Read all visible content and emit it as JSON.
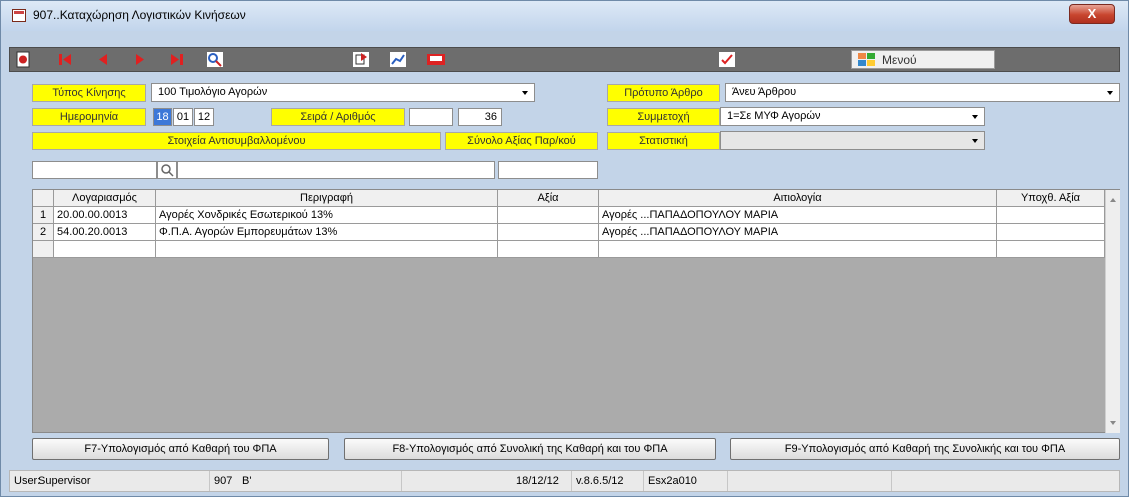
{
  "window": {
    "title": "907..Καταχώρηση Λογιστικών Κινήσεων",
    "close_label": "X"
  },
  "toolbar": {
    "icons": [
      "record-icon",
      "first-icon",
      "prev-icon",
      "next-icon",
      "last-icon",
      "search-icon",
      "copy-icon",
      "chart-icon",
      "print-icon",
      "check-icon",
      "menu-icon"
    ],
    "menu_label": "Μενού"
  },
  "form": {
    "movement_type_label": "Τύπος Κίνησης",
    "movement_type_value": "100 Τιμολόγιο Αγορών",
    "template_label": "Πρότυπο Άρθρο",
    "template_value": "Άνευ Άρθρου",
    "date_label": "Ημερομηνία",
    "date_day": "18",
    "date_month": "01",
    "date_year": "12",
    "series_label": "Σειρά / Αριθμός",
    "series_value": "",
    "number_value": "36",
    "participation_label": "Συμμετοχή",
    "participation_value": "1=Σε ΜΥΦ Αγορών",
    "counterparty_label": "Στοιχεία Αντισυμβαλλομένου",
    "total_value_label": "Σύνολο Αξίας Παρ/κού",
    "statistic_label": "Στατιστική",
    "statistic_value": "",
    "counterparty_code": "",
    "counterparty_name": "",
    "total_value": ""
  },
  "grid": {
    "headers": {
      "num": "",
      "account": "Λογαριασμός",
      "description": "Περιγραφή",
      "value": "Αξία",
      "reason": "Αιτιολογία",
      "liable": "Υποχθ. Αξία"
    },
    "rows": [
      {
        "num": "1",
        "account": "20.00.00.0013",
        "description": "Αγορές Χονδρικές Εσωτερικού 13%",
        "value": "",
        "reason": "Αγορές    ...ΠΑΠΑΔΟΠΟΥΛΟΥ ΜΑΡΙΑ",
        "liable": ""
      },
      {
        "num": "2",
        "account": "54.00.20.0013",
        "description": "Φ.Π.Α. Αγορών Εμπορευμάτων 13%",
        "value": "",
        "reason": "Αγορές    ...ΠΑΠΑΔΟΠΟΥΛΟΥ ΜΑΡΙΑ",
        "liable": ""
      },
      {
        "num": "",
        "account": "",
        "description": "",
        "value": "",
        "reason": "",
        "liable": ""
      }
    ]
  },
  "buttons": {
    "f7": "F7-Υπολογισμός από Καθαρή του ΦΠΑ",
    "f8": "F8-Υπολογισμός από Συνολική της Καθαρή και του ΦΠΑ",
    "f9": "F9-Υπολογισμός από Καθαρή της Συνολικής και του ΦΠΑ"
  },
  "status": {
    "user_label": "User:",
    "user": "Supervisor",
    "code": "907",
    "period": "B'",
    "date": "18/12/12",
    "version": "v.8.6.5/12",
    "db": "Esx2a010"
  }
}
